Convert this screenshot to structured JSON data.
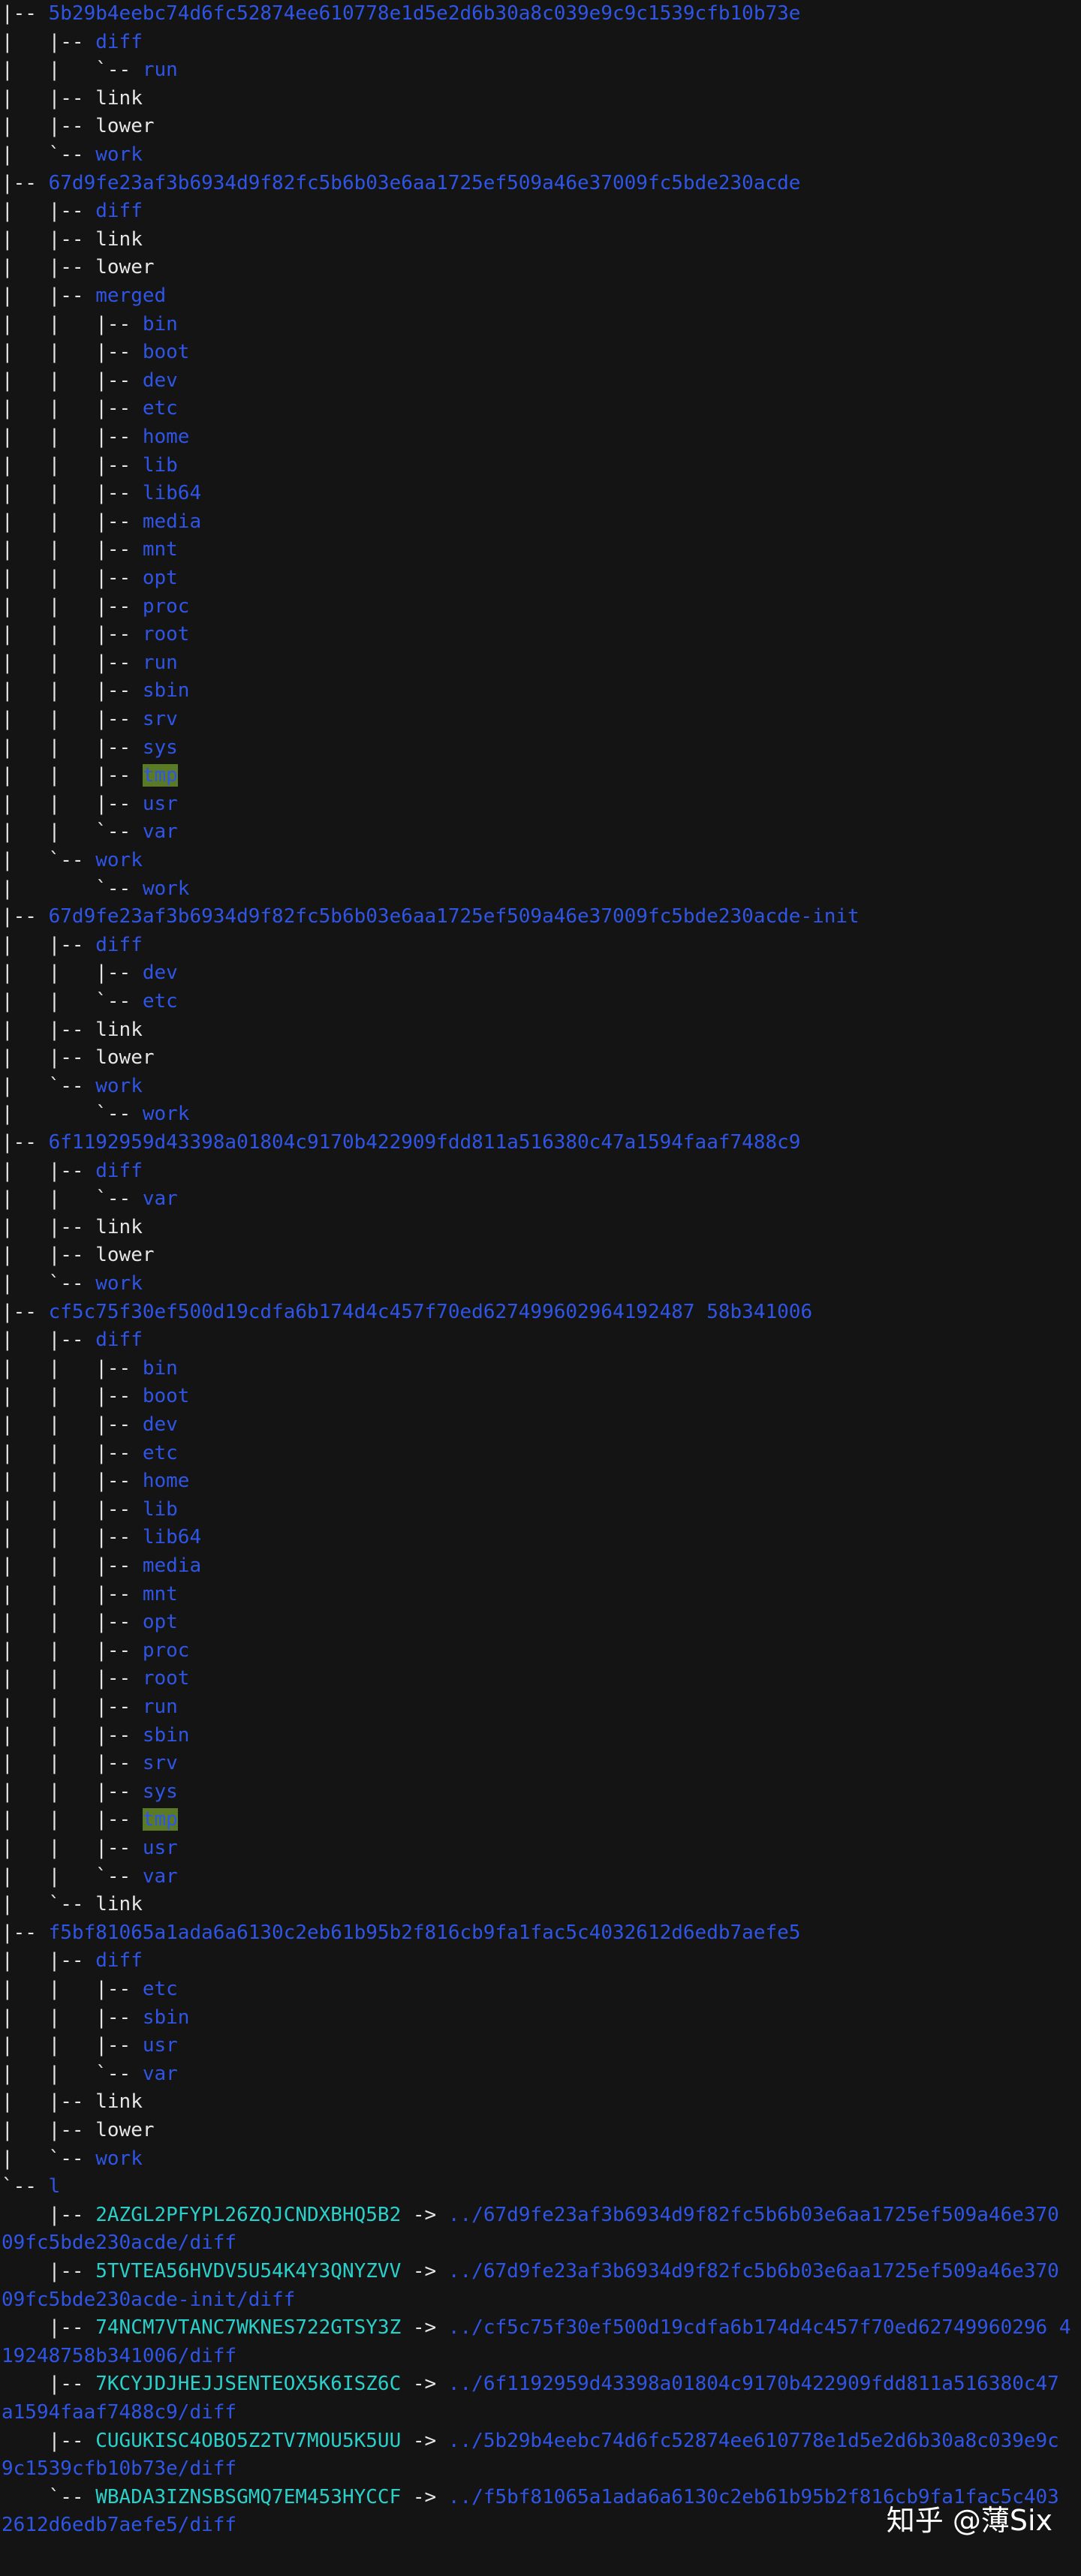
{
  "terminal": {
    "lines": [
      {
        "p": "|-- ",
        "t": "5b29b4eebc74d6fc52874ee610778e1d5e2d6b30a8c039e9c9c1539cfb10b73e",
        "k": "dir"
      },
      {
        "p": "|   |-- ",
        "t": "diff",
        "k": "dir"
      },
      {
        "p": "|   |   `-- ",
        "t": "run",
        "k": "dir"
      },
      {
        "p": "|   |-- ",
        "t": "link",
        "k": "file"
      },
      {
        "p": "|   |-- ",
        "t": "lower",
        "k": "file"
      },
      {
        "p": "|   `-- ",
        "t": "work",
        "k": "dir"
      },
      {
        "p": "|-- ",
        "t": "67d9fe23af3b6934d9f82fc5b6b03e6aa1725ef509a46e37009fc5bde230acde",
        "k": "dir"
      },
      {
        "p": "|   |-- ",
        "t": "diff",
        "k": "dir"
      },
      {
        "p": "|   |-- ",
        "t": "link",
        "k": "file"
      },
      {
        "p": "|   |-- ",
        "t": "lower",
        "k": "file"
      },
      {
        "p": "|   |-- ",
        "t": "merged",
        "k": "dir"
      },
      {
        "p": "|   |   |-- ",
        "t": "bin",
        "k": "dir"
      },
      {
        "p": "|   |   |-- ",
        "t": "boot",
        "k": "dir"
      },
      {
        "p": "|   |   |-- ",
        "t": "dev",
        "k": "dir"
      },
      {
        "p": "|   |   |-- ",
        "t": "etc",
        "k": "dir"
      },
      {
        "p": "|   |   |-- ",
        "t": "home",
        "k": "dir"
      },
      {
        "p": "|   |   |-- ",
        "t": "lib",
        "k": "dir"
      },
      {
        "p": "|   |   |-- ",
        "t": "lib64",
        "k": "dir"
      },
      {
        "p": "|   |   |-- ",
        "t": "media",
        "k": "dir"
      },
      {
        "p": "|   |   |-- ",
        "t": "mnt",
        "k": "dir"
      },
      {
        "p": "|   |   |-- ",
        "t": "opt",
        "k": "dir"
      },
      {
        "p": "|   |   |-- ",
        "t": "proc",
        "k": "dir"
      },
      {
        "p": "|   |   |-- ",
        "t": "root",
        "k": "dir"
      },
      {
        "p": "|   |   |-- ",
        "t": "run",
        "k": "dir"
      },
      {
        "p": "|   |   |-- ",
        "t": "sbin",
        "k": "dir"
      },
      {
        "p": "|   |   |-- ",
        "t": "srv",
        "k": "dir"
      },
      {
        "p": "|   |   |-- ",
        "t": "sys",
        "k": "dir"
      },
      {
        "p": "|   |   |-- ",
        "t": "tmp",
        "k": "hl"
      },
      {
        "p": "|   |   |-- ",
        "t": "usr",
        "k": "dir"
      },
      {
        "p": "|   |   `-- ",
        "t": "var",
        "k": "dir"
      },
      {
        "p": "|   `-- ",
        "t": "work",
        "k": "dir"
      },
      {
        "p": "|       `-- ",
        "t": "work",
        "k": "dir"
      },
      {
        "p": "|-- ",
        "t": "67d9fe23af3b6934d9f82fc5b6b03e6aa1725ef509a46e37009fc5bde230acde-init",
        "k": "dir"
      },
      {
        "p": "|   |-- ",
        "t": "diff",
        "k": "dir"
      },
      {
        "p": "|   |   |-- ",
        "t": "dev",
        "k": "dir"
      },
      {
        "p": "|   |   `-- ",
        "t": "etc",
        "k": "dir"
      },
      {
        "p": "|   |-- ",
        "t": "link",
        "k": "file"
      },
      {
        "p": "|   |-- ",
        "t": "lower",
        "k": "file"
      },
      {
        "p": "|   `-- ",
        "t": "work",
        "k": "dir"
      },
      {
        "p": "|       `-- ",
        "t": "work",
        "k": "dir"
      },
      {
        "p": "|-- ",
        "t": "6f1192959d43398a01804c9170b422909fdd811a516380c47a1594faaf7488c9",
        "k": "dir"
      },
      {
        "p": "|   |-- ",
        "t": "diff",
        "k": "dir"
      },
      {
        "p": "|   |   `-- ",
        "t": "var",
        "k": "dir"
      },
      {
        "p": "|   |-- ",
        "t": "link",
        "k": "file"
      },
      {
        "p": "|   |-- ",
        "t": "lower",
        "k": "file"
      },
      {
        "p": "|   `-- ",
        "t": "work",
        "k": "dir"
      },
      {
        "p": "|-- ",
        "t": "cf5c75f30ef500d19cdfa6b174d4c457f70ed627499602964192487 58b341006",
        "k": "dir"
      },
      {
        "p": "|   |-- ",
        "t": "diff",
        "k": "dir"
      },
      {
        "p": "|   |   |-- ",
        "t": "bin",
        "k": "dir"
      },
      {
        "p": "|   |   |-- ",
        "t": "boot",
        "k": "dir"
      },
      {
        "p": "|   |   |-- ",
        "t": "dev",
        "k": "dir"
      },
      {
        "p": "|   |   |-- ",
        "t": "etc",
        "k": "dir"
      },
      {
        "p": "|   |   |-- ",
        "t": "home",
        "k": "dir"
      },
      {
        "p": "|   |   |-- ",
        "t": "lib",
        "k": "dir"
      },
      {
        "p": "|   |   |-- ",
        "t": "lib64",
        "k": "dir"
      },
      {
        "p": "|   |   |-- ",
        "t": "media",
        "k": "dir"
      },
      {
        "p": "|   |   |-- ",
        "t": "mnt",
        "k": "dir"
      },
      {
        "p": "|   |   |-- ",
        "t": "opt",
        "k": "dir"
      },
      {
        "p": "|   |   |-- ",
        "t": "proc",
        "k": "dir"
      },
      {
        "p": "|   |   |-- ",
        "t": "root",
        "k": "dir"
      },
      {
        "p": "|   |   |-- ",
        "t": "run",
        "k": "dir"
      },
      {
        "p": "|   |   |-- ",
        "t": "sbin",
        "k": "dir"
      },
      {
        "p": "|   |   |-- ",
        "t": "srv",
        "k": "dir"
      },
      {
        "p": "|   |   |-- ",
        "t": "sys",
        "k": "dir"
      },
      {
        "p": "|   |   |-- ",
        "t": "tmp",
        "k": "hl"
      },
      {
        "p": "|   |   |-- ",
        "t": "usr",
        "k": "dir"
      },
      {
        "p": "|   |   `-- ",
        "t": "var",
        "k": "dir"
      },
      {
        "p": "|   `-- ",
        "t": "link",
        "k": "file"
      },
      {
        "p": "|-- ",
        "t": "f5bf81065a1ada6a6130c2eb61b95b2f816cb9fa1fac5c4032612d6edb7aefe5",
        "k": "dir"
      },
      {
        "p": "|   |-- ",
        "t": "diff",
        "k": "dir"
      },
      {
        "p": "|   |   |-- ",
        "t": "etc",
        "k": "dir"
      },
      {
        "p": "|   |   |-- ",
        "t": "sbin",
        "k": "dir"
      },
      {
        "p": "|   |   |-- ",
        "t": "usr",
        "k": "dir"
      },
      {
        "p": "|   |   `-- ",
        "t": "var",
        "k": "dir"
      },
      {
        "p": "|   |-- ",
        "t": "link",
        "k": "file"
      },
      {
        "p": "|   |-- ",
        "t": "lower",
        "k": "file"
      },
      {
        "p": "|   `-- ",
        "t": "work",
        "k": "dir"
      },
      {
        "p": "`-- ",
        "t": "l",
        "k": "dir"
      },
      {
        "p": "    |-- ",
        "t": "2AZGL2PFYPL26ZQJCNDXBHQ5B2",
        "k": "link",
        "a": " -> ",
        "g": "../67d9fe23af3b6934d9f82fc5b6b03e6aa1725ef509a46e370"
      },
      {
        "p": "",
        "t": "09fc5bde230acde/diff",
        "k": "target"
      },
      {
        "p": "    |-- ",
        "t": "5TVTEA56HVDV5U54K4Y3QNYZVV",
        "k": "link",
        "a": " -> ",
        "g": "../67d9fe23af3b6934d9f82fc5b6b03e6aa1725ef509a46e370"
      },
      {
        "p": "",
        "t": "09fc5bde230acde-init/diff",
        "k": "target"
      },
      {
        "p": "    |-- ",
        "t": "74NCM7VTANC7WKNES722GTSY3Z",
        "k": "link",
        "a": " -> ",
        "g": "../cf5c75f30ef500d19cdfa6b174d4c457f70ed62749960296 4"
      },
      {
        "p": "",
        "t": "19248758b341006/diff",
        "k": "target"
      },
      {
        "p": "    |-- ",
        "t": "7KCYJDJHEJJSENTEOX5K6ISZ6C",
        "k": "link",
        "a": " -> ",
        "g": "../6f1192959d43398a01804c9170b422909fdd811a516380c47"
      },
      {
        "p": "",
        "t": "a1594faaf7488c9/diff",
        "k": "target"
      },
      {
        "p": "    |-- ",
        "t": "CUGUKISC4OBO5Z2TV7MOU5K5UU",
        "k": "link",
        "a": " -> ",
        "g": "../5b29b4eebc74d6fc52874ee610778e1d5e2d6b30a8c039e9c"
      },
      {
        "p": "",
        "t": "9c1539cfb10b73e/diff",
        "k": "target"
      },
      {
        "p": "    `-- ",
        "t": "WBADA3IZNSBSGMQ7EM453HYCCF",
        "k": "link",
        "a": " -> ",
        "g": "../f5bf81065a1ada6a6130c2eb61b95b2f816cb9fa1fac5c403"
      },
      {
        "p": "",
        "t": "2612d6edb7aefe5/diff",
        "k": "target"
      }
    ]
  },
  "watermark": {
    "text": "知乎 @薄Six"
  },
  "colors": {
    "background": "#141414",
    "text": "#e6e6e6",
    "directory": "#2f55e6",
    "symlink": "#2ad0c9",
    "highlight_bg": "#5a7a26"
  }
}
